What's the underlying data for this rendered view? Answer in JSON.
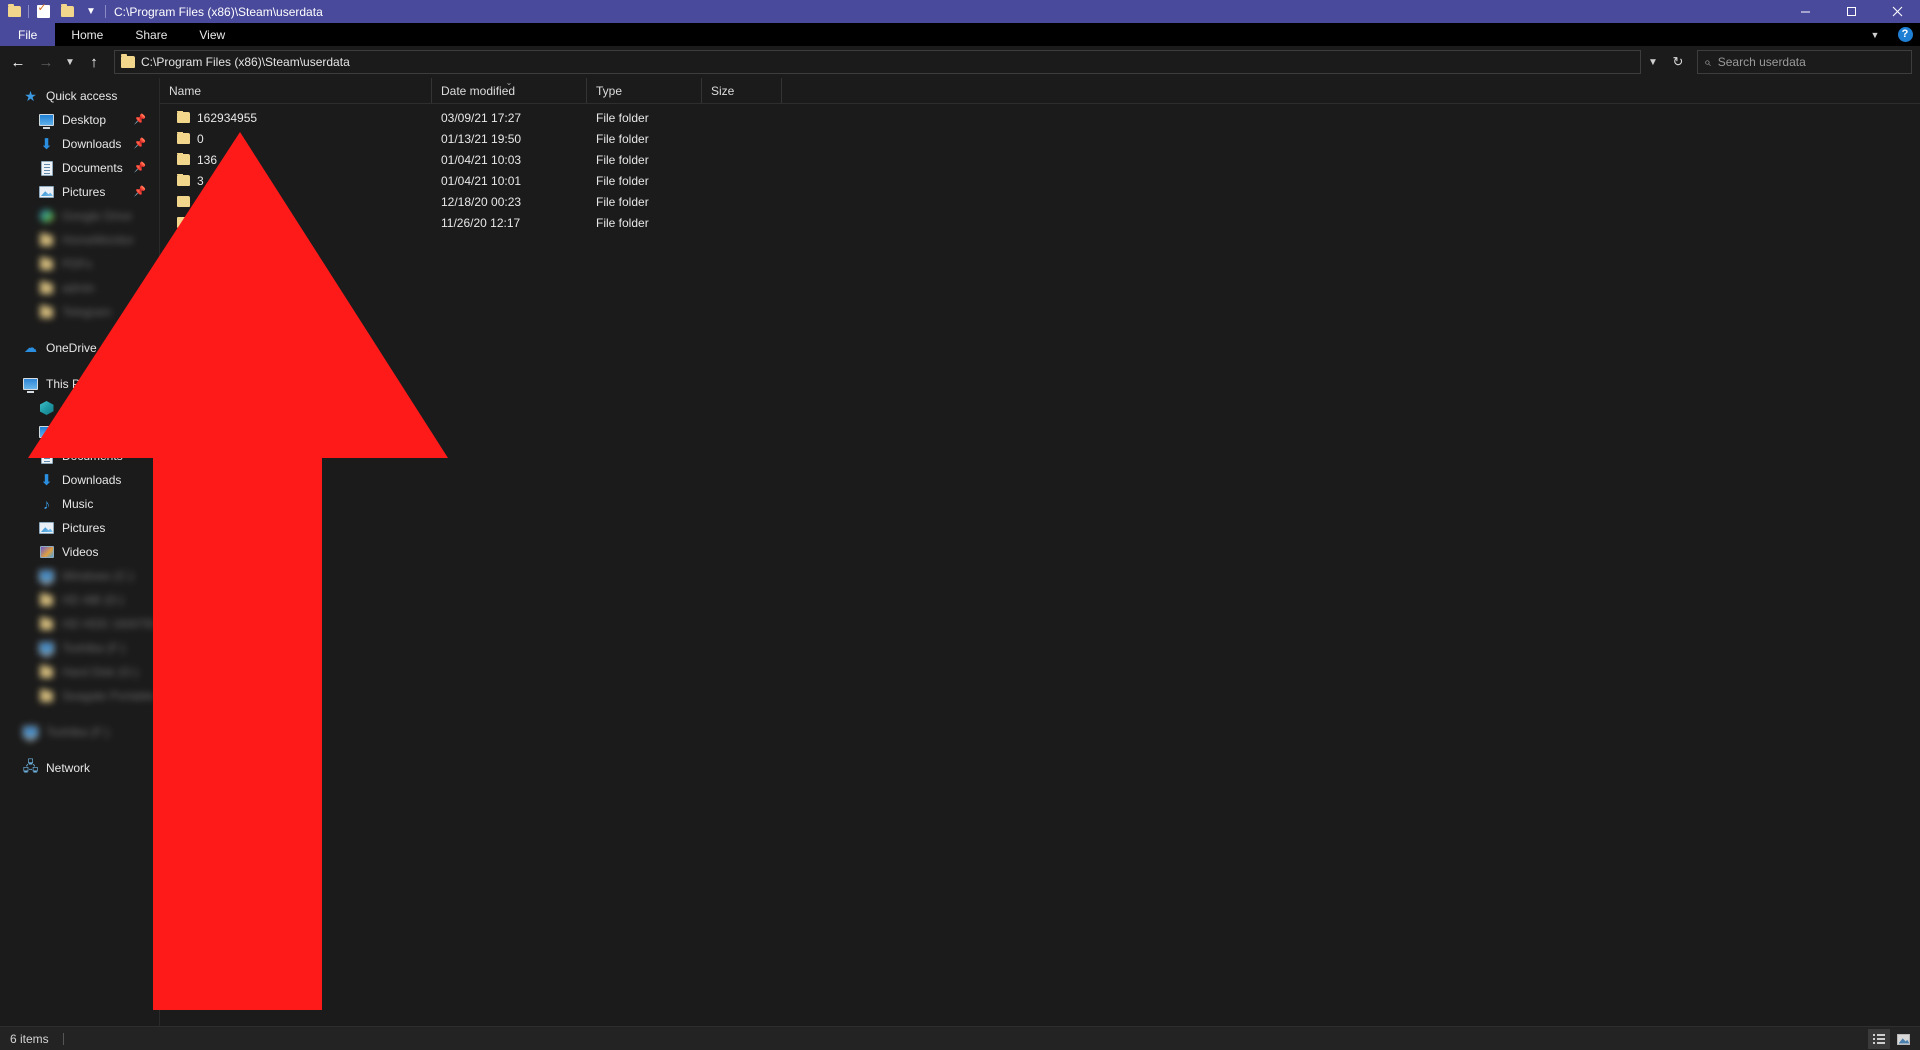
{
  "window": {
    "title": "C:\\Program Files (x86)\\Steam\\userdata",
    "quick_access_toolbar": [
      {
        "name": "folder-icon",
        "label": ""
      },
      {
        "name": "properties-icon",
        "label": ""
      },
      {
        "name": "new-folder-icon",
        "label": ""
      },
      {
        "name": "customize-chevron-icon",
        "label": "⌄"
      }
    ],
    "controls": {
      "minimize": "Minimize",
      "maximize": "Maximize",
      "close": "Close"
    }
  },
  "ribbon": {
    "tabs": [
      {
        "label": "File",
        "active": true
      },
      {
        "label": "Home",
        "active": false
      },
      {
        "label": "Share",
        "active": false
      },
      {
        "label": "View",
        "active": false
      }
    ],
    "collapse_label": "⌄",
    "help_label": "?"
  },
  "navbar": {
    "back": "←",
    "forward": "→",
    "recent": "⌄",
    "up": "↑",
    "address_value": "C:\\Program Files (x86)\\Steam\\userdata",
    "address_dropdown": "⌄",
    "refresh": "↻"
  },
  "search": {
    "placeholder": "Search userdata",
    "value": "",
    "icon": "search-icon"
  },
  "sidebar": {
    "quick_access": {
      "label": "Quick access",
      "icon": "star-icon",
      "items": [
        {
          "label": "Desktop",
          "icon": "desktop-icon",
          "pinned": true,
          "blurred": false
        },
        {
          "label": "Downloads",
          "icon": "download-icon",
          "pinned": true,
          "blurred": false
        },
        {
          "label": "Documents",
          "icon": "document-icon",
          "pinned": true,
          "blurred": false
        },
        {
          "label": "Pictures",
          "icon": "picture-icon",
          "pinned": true,
          "blurred": false
        },
        {
          "label": "Google Drive",
          "icon": "drive-icon",
          "pinned": true,
          "blurred": true
        },
        {
          "label": "HomeMonitor",
          "icon": "folder-icon",
          "pinned": false,
          "blurred": true
        },
        {
          "label": "PDFs",
          "icon": "folder-icon",
          "pinned": false,
          "blurred": true
        },
        {
          "label": "admin",
          "icon": "folder-icon",
          "pinned": false,
          "blurred": true
        },
        {
          "label": "Telegram",
          "icon": "folder-icon",
          "pinned": false,
          "blurred": true
        }
      ]
    },
    "onedrive": {
      "label": "OneDrive",
      "icon": "cloud-icon"
    },
    "this_pc": {
      "label": "This PC",
      "icon": "pc-icon",
      "items": [
        {
          "label": "3D Objects",
          "icon": "3d-objects-icon",
          "blurred": false
        },
        {
          "label": "Desktop",
          "icon": "desktop-icon",
          "blurred": false
        },
        {
          "label": "Documents",
          "icon": "document-icon",
          "blurred": false
        },
        {
          "label": "Downloads",
          "icon": "download-icon",
          "blurred": false
        },
        {
          "label": "Music",
          "icon": "music-icon",
          "blurred": false
        },
        {
          "label": "Pictures",
          "icon": "picture-icon",
          "blurred": false
        },
        {
          "label": "Videos",
          "icon": "video-icon",
          "blurred": false
        },
        {
          "label": "Windows (C:)",
          "icon": "drive-icon",
          "blurred": true
        },
        {
          "label": "HD 4tB (D:)",
          "icon": "drive-icon",
          "blurred": true
        },
        {
          "label": "HD HDD 1600TB (E:)",
          "icon": "drive-icon",
          "blurred": true
        },
        {
          "label": "Toshiba (F:)",
          "icon": "drive-icon",
          "blurred": true
        },
        {
          "label": "Hard Disk (G:)",
          "icon": "drive-icon",
          "blurred": true
        },
        {
          "label": "Seagate Portable",
          "icon": "drive-icon",
          "blurred": true
        }
      ]
    },
    "removable": {
      "label": "Toshiba (F:)",
      "icon": "drive-icon",
      "blurred": true
    },
    "network": {
      "label": "Network",
      "icon": "network-icon"
    }
  },
  "filelist": {
    "columns": [
      {
        "label": "Name",
        "sorted": false
      },
      {
        "label": "Date modified",
        "sorted": true
      },
      {
        "label": "Type",
        "sorted": false
      },
      {
        "label": "Size",
        "sorted": false
      }
    ],
    "sort_caret": "⌄",
    "rows": [
      {
        "name": "162934955",
        "date": "03/09/21 17:27",
        "type": "File folder",
        "size": "",
        "icon": "folder-icon"
      },
      {
        "name": "0",
        "date": "01/13/21 19:50",
        "type": "File folder",
        "size": "",
        "icon": "folder-icon"
      },
      {
        "name": "136",
        "date": "01/04/21 10:03",
        "type": "File folder",
        "size": "",
        "icon": "folder-icon"
      },
      {
        "name": "3",
        "date": "01/04/21 10:01",
        "type": "File folder",
        "size": "",
        "icon": "folder-icon"
      },
      {
        "name": "",
        "date": "12/18/20 00:23",
        "type": "File folder",
        "size": "",
        "icon": "folder-icon"
      },
      {
        "name": "",
        "date": "11/26/20 12:17",
        "type": "File folder",
        "size": "",
        "icon": "folder-icon"
      }
    ]
  },
  "statusbar": {
    "item_count": "6 items",
    "view_details": "Details view",
    "view_large_icons": "Large icons view"
  },
  "annotation": {
    "type": "arrow",
    "color": "#FF1A1A",
    "direction": "up",
    "description": "Large red up arrow pointing at the folder list"
  },
  "colors": {
    "titlebar": "#4a4a9c",
    "background": "#1b1b1b",
    "ribbon": "#000000",
    "accent_blue": "#1f7fd4",
    "folder_yellow": "#f2d68c",
    "arrow_red": "#FF1A1A"
  }
}
